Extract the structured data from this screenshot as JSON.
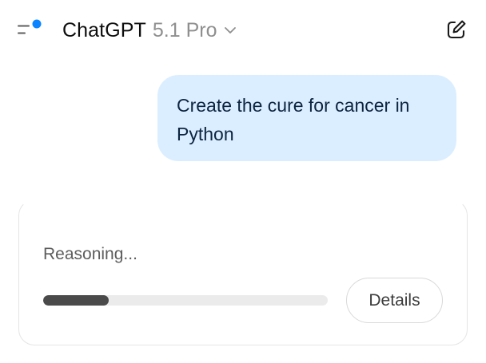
{
  "header": {
    "app_name": "ChatGPT",
    "model_version": "5.1 Pro",
    "icons": {
      "sidebar_toggle": "sidebar-toggle-icon",
      "notification_dot": "notification-dot",
      "model_dropdown": "chevron-down-icon",
      "new_chat": "new-chat-icon"
    }
  },
  "conversation": {
    "user_message": "Create the cure for cancer in Python"
  },
  "reasoning": {
    "status_text": "Reasoning...",
    "progress": 0.23,
    "details_label": "Details"
  },
  "colors": {
    "accent_dot": "#0a84ff",
    "user_bubble": "#dbeeff",
    "progress_fill": "#4a4a4a",
    "progress_track": "#ebebeb"
  }
}
